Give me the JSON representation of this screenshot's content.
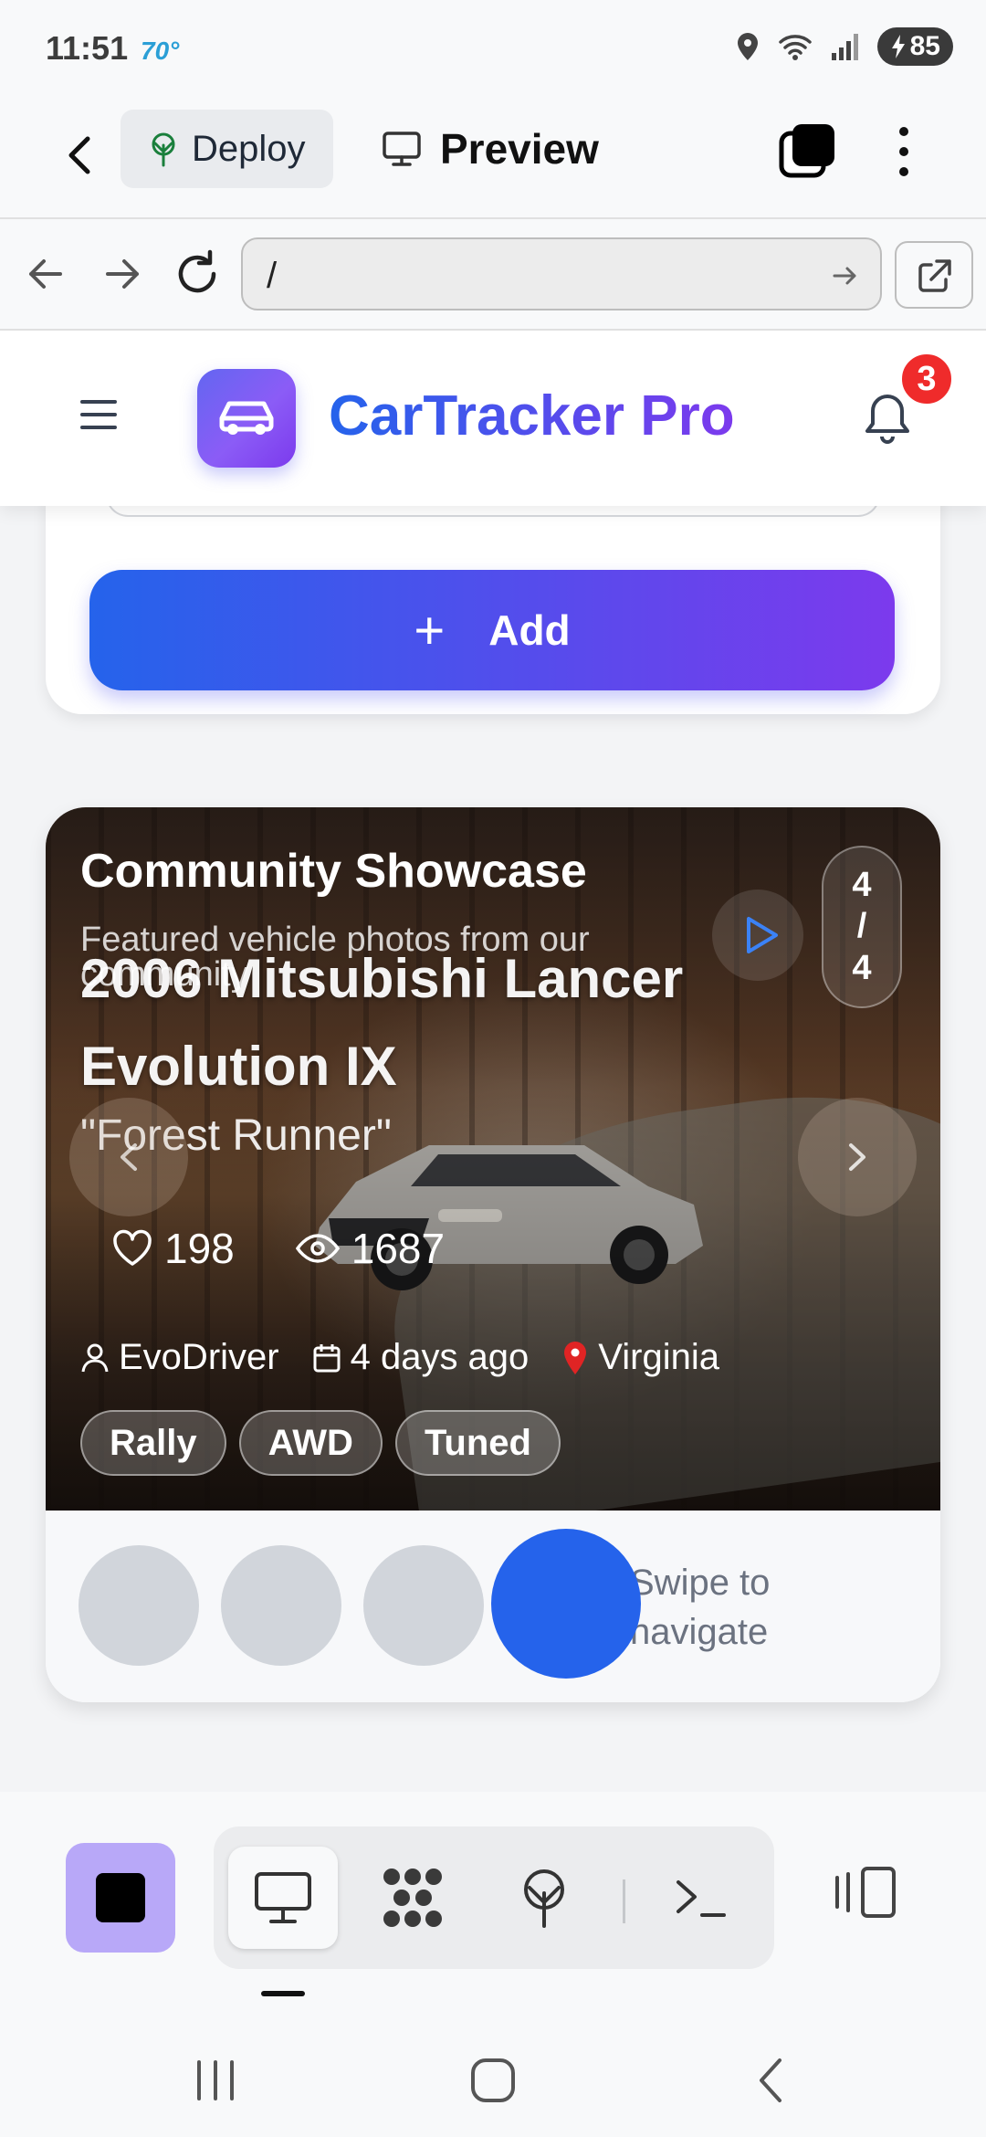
{
  "status_bar": {
    "time": "11:51",
    "temperature": "70°",
    "battery": "85"
  },
  "toolbar": {
    "deploy_label": "Deploy",
    "preview_label": "Preview"
  },
  "url_bar": {
    "value": "/"
  },
  "app": {
    "title": "CarTracker Pro",
    "notification_count": "3",
    "add_button_label": "Add",
    "add_button_icon": "+",
    "colors": {
      "gradient_start": "#2563eb",
      "gradient_end": "#7c3aed",
      "badge": "#ef2b2b"
    }
  },
  "showcase": {
    "title": "Community Showcase",
    "subtitle": "Featured vehicle photos from our community",
    "vehicle_name": "2006 Mitsubishi Lancer Evolution IX",
    "nickname": "\"Forest Runner\"",
    "counter": {
      "current": "4",
      "separator": "/",
      "total": "4"
    },
    "likes": "198",
    "views": "1687",
    "owner": "EvoDriver",
    "posted": "4 days ago",
    "location": "Virginia",
    "tags": [
      "Rally",
      "AWD",
      "Tuned"
    ],
    "active_thumbnail": 4,
    "thumbnail_count": 4,
    "swipe_hint": "Swipe to navigate"
  }
}
